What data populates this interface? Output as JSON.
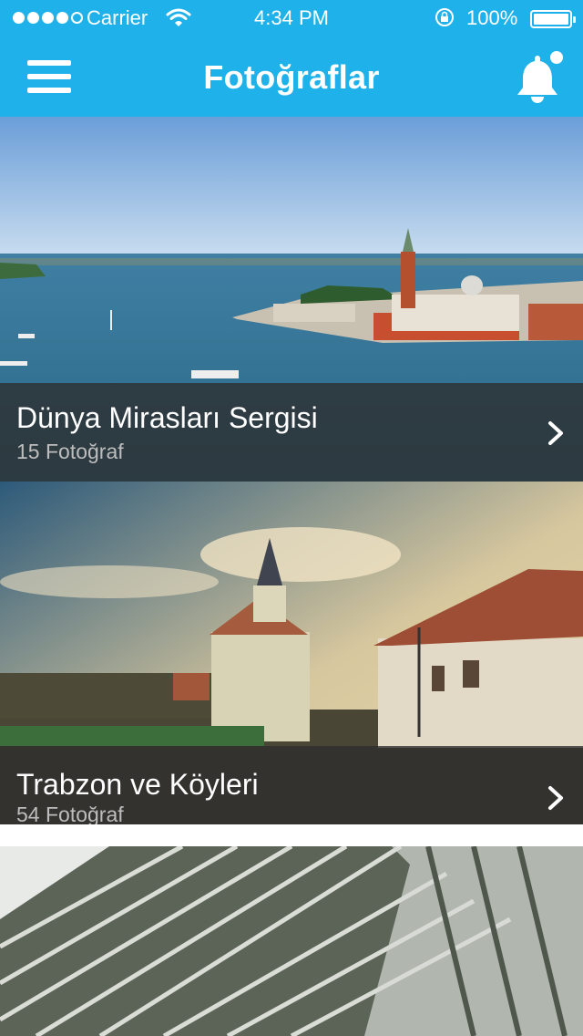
{
  "status_bar": {
    "carrier": "Carrier",
    "time": "4:34 PM",
    "battery": "100%"
  },
  "nav": {
    "title": "Fotoğraflar",
    "menu_icon": "hamburger-menu-icon",
    "bell_icon": "bell-icon"
  },
  "colors": {
    "accent": "#1fb1ea",
    "caption_overlay": "#2d2d2d",
    "caption_title": "#ffffff",
    "caption_count": "#bdbdbd"
  },
  "albums": [
    {
      "title": "Dünya Mirasları Sergisi",
      "count": "15 Fotoğraf"
    },
    {
      "title": "Trabzon ve Köyleri",
      "count": "54 Fotoğraf"
    }
  ]
}
